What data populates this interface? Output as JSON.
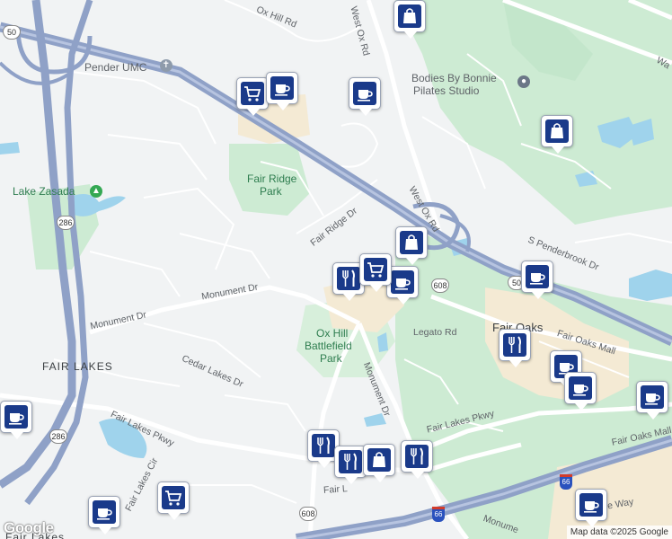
{
  "colors": {
    "background": "#f1f3f4",
    "park": "#cdebd3",
    "water": "#9fd3ec",
    "highway": "#8fa1c7",
    "road": "#ffffff",
    "commercial": "#f4ead4",
    "pin_icon": "#1a3a8a"
  },
  "labels": {
    "ox_hill_rd": "Ox Hill Rd",
    "west_ox_rd_top": "West Ox Rd",
    "pender_umc": "Pender UMC",
    "bodies_by_bonnie_line1": "Bodies By Bonnie",
    "bodies_by_bonnie_line2": "Pilates Studio",
    "lake_zasada": "Lake Zasada",
    "fair_ridge_park_line1": "Fair Ridge",
    "fair_ridge_park_line2": "Park",
    "west_ox_rd": "West Ox Rd",
    "fair_ridge_dr": "Fair Ridge Dr",
    "s_penderbrook_dr": "S Penderbrook Dr",
    "monument_dr_west": "Monument Dr",
    "monument_dr_mid": "Monument Dr",
    "fair_oaks": "Fair Oaks",
    "fair_oaks_mall_road": "Fair Oaks Mall",
    "ox_hill_battlefield_line1": "Ox Hill",
    "ox_hill_battlefield_line2": "Battlefield",
    "ox_hill_battlefield_line3": "Park",
    "legato_rd": "Legato Rd",
    "fair_lakes": "FAIR LAKES",
    "cedar_lakes_dr": "Cedar Lakes Dr",
    "monument_dr_south": "Monument Dr",
    "fair_lakes_pkwy_east": "Fair Lakes Pkwy",
    "fair_oaks_mall_rd": "Fair Oaks Mall",
    "fair_lakes_pkwy_west": "Fair Lakes Pkwy",
    "fair_lakes_cir": "Fair Lakes Cir",
    "fair_l_bottom": "Fair L",
    "monume_bottom": "Monume",
    "fair_lakes_cutoff": "Fair Lakes",
    "e_way": "e Way",
    "wa_cutoff": "Wa",
    "shield_50_west": "50",
    "shield_50_east": "50",
    "shield_286_top": "286",
    "shield_286_bottom": "286",
    "shield_608_mid": "608",
    "shield_608_bottom": "608",
    "shield_66_east": "66",
    "shield_66_south": "66"
  },
  "pins": [
    {
      "type": "shopping-bag",
      "label": "Shopping"
    },
    {
      "type": "shopping-cart",
      "label": "Grocery"
    },
    {
      "type": "coffee",
      "label": "Cafe"
    },
    {
      "type": "coffee",
      "label": "Cafe"
    },
    {
      "type": "shopping-bag",
      "label": "Shopping"
    },
    {
      "type": "coffee",
      "label": "Cafe"
    },
    {
      "type": "shopping-bag",
      "label": "Shopping"
    },
    {
      "type": "restaurant",
      "label": "Restaurant"
    },
    {
      "type": "coffee",
      "label": "Cafe"
    },
    {
      "type": "shopping-cart",
      "label": "Grocery"
    },
    {
      "type": "restaurant",
      "label": "Restaurant"
    },
    {
      "type": "coffee",
      "label": "Cafe"
    },
    {
      "type": "coffee",
      "label": "Cafe"
    },
    {
      "type": "coffee",
      "label": "Cafe"
    },
    {
      "type": "restaurant",
      "label": "Restaurant"
    },
    {
      "type": "restaurant",
      "label": "Restaurant"
    },
    {
      "type": "shopping-bag",
      "label": "Shopping"
    },
    {
      "type": "restaurant",
      "label": "Restaurant"
    },
    {
      "type": "coffee",
      "label": "Cafe"
    },
    {
      "type": "shopping-cart",
      "label": "Grocery"
    },
    {
      "type": "coffee",
      "label": "Cafe"
    },
    {
      "type": "coffee",
      "label": "Cafe"
    }
  ],
  "google_logo": "Google",
  "attribution": "Map data ©2025 Google"
}
